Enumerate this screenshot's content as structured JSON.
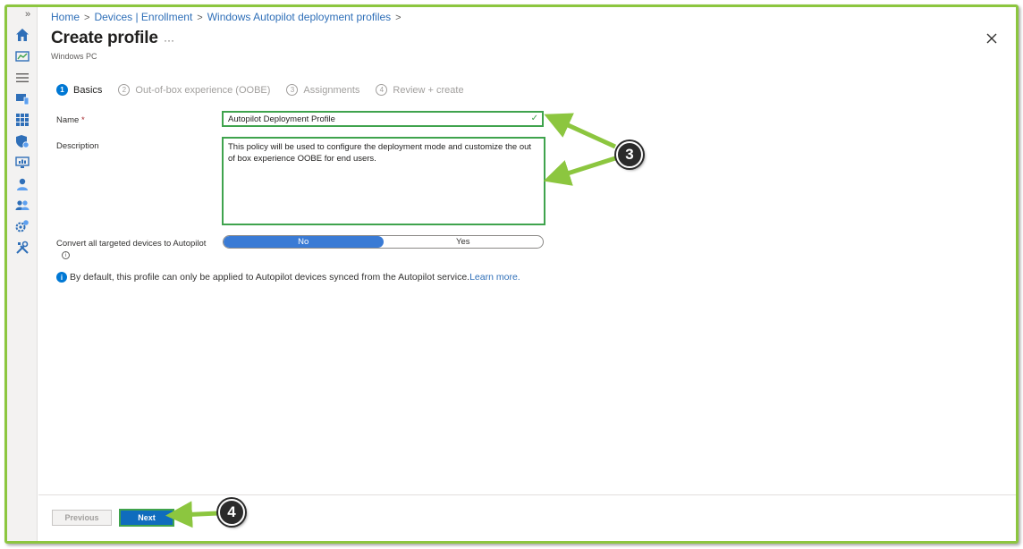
{
  "breadcrumb": {
    "items": [
      "Home",
      "Devices | Enrollment",
      "Windows Autopilot deployment profiles"
    ]
  },
  "header": {
    "title": "Create profile",
    "more": "···",
    "subtitle": "Windows PC"
  },
  "nav": {
    "expand": "»",
    "icons": [
      "home-icon",
      "dashboard-icon",
      "all-services-icon",
      "devices-icon",
      "apps-icon",
      "endpoint-security-icon",
      "reports-icon",
      "users-icon",
      "groups-icon",
      "tenant-admin-icon",
      "troubleshooting-icon"
    ]
  },
  "steps": [
    {
      "num": "1",
      "label": "Basics"
    },
    {
      "num": "2",
      "label": "Out-of-box experience (OOBE)"
    },
    {
      "num": "3",
      "label": "Assignments"
    },
    {
      "num": "4",
      "label": "Review + create"
    }
  ],
  "form": {
    "name_label": "Name",
    "required_mark": "*",
    "name_value": "Autopilot Deployment Profile",
    "description_label": "Description",
    "description_value": "This policy will be used to configure the deployment mode and customize the out of box experience OOBE for end users.",
    "convert_label": "Convert all targeted devices to Autopilot",
    "toggle_no": "No",
    "toggle_yes": "Yes",
    "info_glyph": "i"
  },
  "notice": {
    "text": "By default, this profile can only be applied to Autopilot devices synced from the Autopilot service.",
    "link": "Learn more.",
    "icon_glyph": "i"
  },
  "footer": {
    "previous_label": "Previous",
    "next_label": "Next"
  },
  "callouts": {
    "three": "3",
    "four": "4"
  },
  "colors": {
    "accent": "#0078d4",
    "highlight_green": "#3fa34d",
    "arrow_green": "#8cc63f"
  }
}
